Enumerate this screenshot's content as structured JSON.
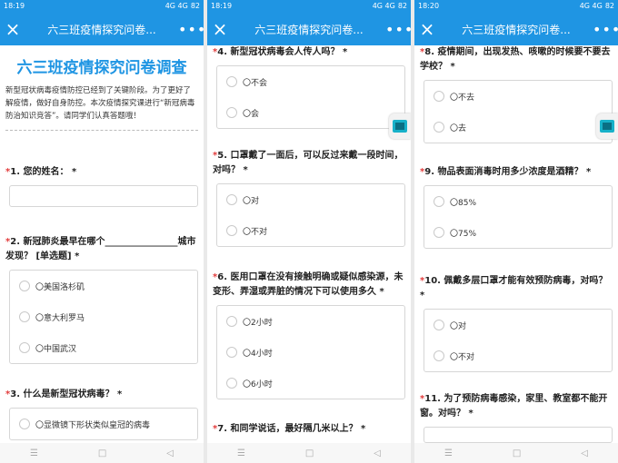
{
  "status": {
    "s1_time": "18:19",
    "s2_time": "18:19",
    "s3_time": "18:20",
    "signal": "4G 4G",
    "battery": "82"
  },
  "titlebar": {
    "title": "六三班疫情探究问卷...",
    "close": "×",
    "more": "•••"
  },
  "survey": {
    "heading": "六三班疫情探究问卷调查",
    "description": "新型冠状病毒疫情防控已经到了关键阶段。为了更好了解疫情，做好自身防控。本次疫情探究课进行“新冠病毒防治知识竞答”。请同学们认真答题哦！"
  },
  "q1": {
    "req": "*",
    "text": "1. 您的姓名：",
    "suffix": " *"
  },
  "q2": {
    "req": "*",
    "text": "2. 新冠肺炎最早在哪个________________城市发现？ [单选题]",
    "suffix": " *",
    "options": [
      "〇美国洛杉矶",
      "〇意大利罗马",
      "〇中国武汉"
    ]
  },
  "q3": {
    "req": "*",
    "text": "3. 什么是新型冠状病毒？",
    "suffix": " *",
    "options": [
      "〇显微镜下形状类似皇冠的病毒"
    ]
  },
  "q4": {
    "req": "*",
    "text": "4. 新型冠状病毒会人传人吗？",
    "suffix": " *",
    "options": [
      "〇不会",
      "〇会"
    ]
  },
  "q5": {
    "req": "*",
    "text": "5. 口罩戴了一面后，可以反过来戴一段时间，对吗？",
    "suffix": " *",
    "options": [
      "〇对",
      "〇不对"
    ]
  },
  "q6": {
    "req": "*",
    "text": "6. 医用口罩在没有接触明确或疑似感染源，未变形、弄湿或弄脏的情况下可以使用多久",
    "suffix": " *",
    "options": [
      "〇2小时",
      "〇4小时",
      "〇6小时"
    ]
  },
  "q7": {
    "req": "*",
    "text": "7. 和同学说话，最好隔几米以上？",
    "suffix": " *"
  },
  "q8": {
    "req": "*",
    "text": "8. 疫情期间，出现发热、咳嗽的时候要不要去学校？",
    "suffix": " *",
    "options": [
      "〇不去",
      "〇去"
    ]
  },
  "q9": {
    "req": "*",
    "text": "9. 物品表面消毒时用多少浓度是酒精？",
    "suffix": " *",
    "options": [
      "〇85%",
      "〇75%"
    ]
  },
  "q10": {
    "req": "*",
    "text": "10. 佩戴多层口罩才能有效预防病毒，对吗？",
    "suffix": " *",
    "options": [
      "〇对",
      "〇不对"
    ]
  },
  "q11": {
    "req": "*",
    "text": "11. 为了预防病毒感染，家里、教室都不能开窗。对吗？",
    "suffix": " *"
  },
  "nav": {
    "menu": "☰",
    "home": "□",
    "back": "◁"
  },
  "colors": {
    "accent": "#1f95e3",
    "required": "#e23b3b"
  },
  "icons": {
    "side": "floating-tool-icon"
  }
}
